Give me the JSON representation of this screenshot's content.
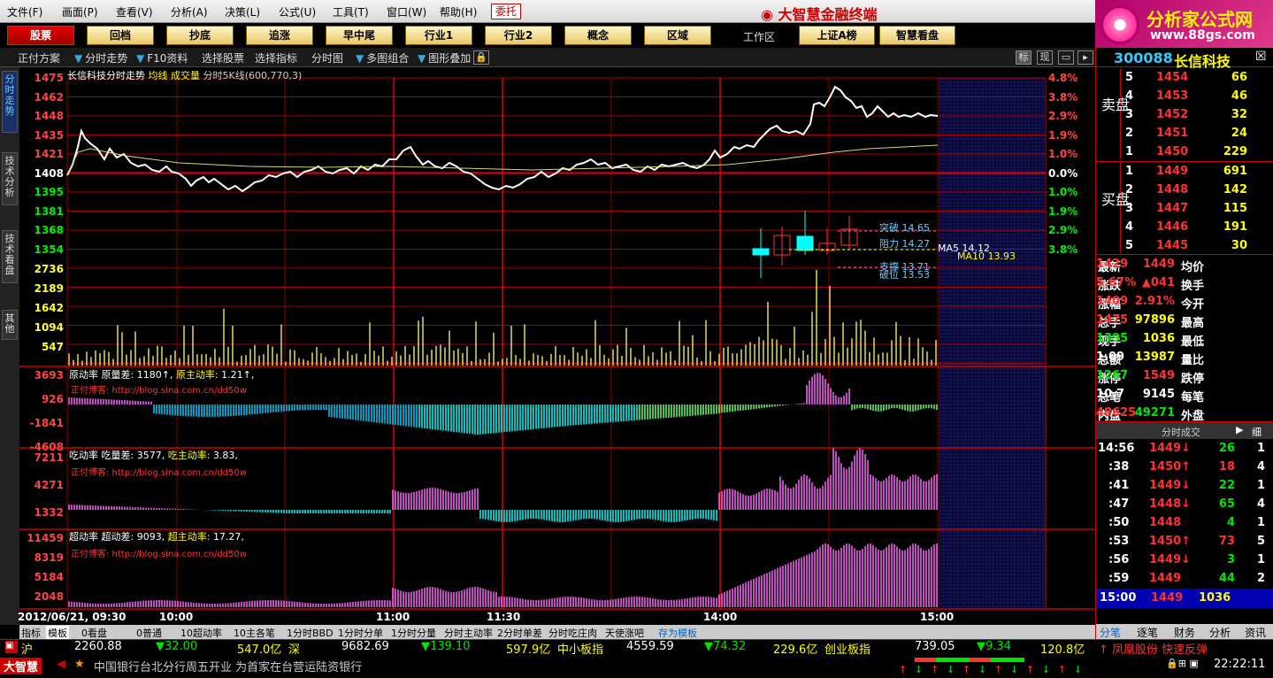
{
  "menu": [
    "文件(F)",
    "画面(P)",
    "查看(V)",
    "分析(A)",
    "决策(L)",
    "公式(U)",
    "工具(T)",
    "窗口(W)",
    "帮助(H)"
  ],
  "weituo": "委托",
  "brand_title": "大智慧金融终端",
  "logo": {
    "line1": "分析家公式网",
    "line2": "www.88gs.com"
  },
  "quick_buttons": [
    "股票",
    "回档",
    "抄底",
    "追涨",
    "早中尾",
    "行业1",
    "行业2",
    "概念",
    "区域"
  ],
  "workspace_label": "工作区",
  "workspace_buttons": [
    "上证A榜",
    "智慧看盘"
  ],
  "toolbar": [
    "正付方案",
    "分时走势",
    "F10资料",
    "选择股票",
    "选择指标",
    "分时图",
    "多图组合",
    "图形叠加"
  ],
  "toolbar_right": [
    "标",
    "现"
  ],
  "side_tabs": [
    "分时走势",
    "技术分析",
    "技术看盘",
    "其他"
  ],
  "chart": {
    "header_title": "长信科技分时走势",
    "header_avg": "均线",
    "header_vol": "成交量",
    "header_ma": "分时5K线(600,770,3)",
    "price_ticks": [
      "1475",
      "1462",
      "1448",
      "1435",
      "1421",
      "1408",
      "1395",
      "1381",
      "1368",
      "1354"
    ],
    "pct_ticks": [
      "4.8%",
      "3.8%",
      "2.9%",
      "1.9%",
      "1.0%",
      "0.0%",
      "1.0%",
      "1.9%",
      "2.9%",
      "3.8%"
    ],
    "vol_ticks": [
      "2736",
      "2189",
      "1642",
      "1094",
      "547"
    ],
    "candle_labels": {
      "tupo": "突破 14.65",
      "zuli": "阻力 14.27",
      "ma5": "MA5 14.12",
      "ma10": "MA10 13.93",
      "zhicheng": "支撑 13.71",
      "dixian": "破位 13.53"
    },
    "panel1": {
      "title_a": "原动率",
      "title_b": "原量差:",
      "val_b": "1180↑,",
      "title_c": "原主动率:",
      "val_c": "1.21↑,",
      "ticks": [
        "3693",
        "926",
        "-1841",
        "-4608"
      ]
    },
    "panel2": {
      "title_a": "吃动率",
      "title_b": "吃量差:",
      "val_b": "3577,",
      "title_c": "吃主动率:",
      "val_c": "3.83,",
      "ticks": [
        "7211",
        "4271",
        "1332"
      ]
    },
    "panel3": {
      "title_a": "超动率",
      "title_b": "超动差:",
      "val_b": "9093,",
      "title_c": "超主动率:",
      "val_c": "17.27,",
      "ticks": [
        "11459",
        "8319",
        "5184",
        "2048"
      ]
    },
    "blog_text": "正付博客: http://blog.sina.com.cn/dd50w",
    "time_labels": [
      "2012/06/21, 09:30",
      "10:00",
      "11:00",
      "11:30",
      "14:00",
      "15:00"
    ]
  },
  "bottom_tabs": [
    "指标",
    "模板",
    "0看盘",
    "0普通",
    "10超动率",
    "10主各笔",
    "1分时BBD",
    "1分时分单",
    "1分时分量",
    "分时主动率",
    "2分时单差",
    "分时吃庄肉",
    "天使涨吧",
    "存为模板"
  ],
  "quote": {
    "code": "300088",
    "name": "长信科技",
    "sell_label": "卖盘",
    "buy_label": "买盘",
    "asks": [
      {
        "n": "5",
        "p": "1454",
        "v": "66"
      },
      {
        "n": "4",
        "p": "1453",
        "v": "46"
      },
      {
        "n": "3",
        "p": "1452",
        "v": "32"
      },
      {
        "n": "2",
        "p": "1451",
        "v": "24"
      },
      {
        "n": "1",
        "p": "1450",
        "v": "229"
      }
    ],
    "bids": [
      {
        "n": "1",
        "p": "1449",
        "v": "691"
      },
      {
        "n": "2",
        "p": "1448",
        "v": "142"
      },
      {
        "n": "3",
        "p": "1447",
        "v": "115"
      },
      {
        "n": "4",
        "p": "1446",
        "v": "191"
      },
      {
        "n": "5",
        "p": "1445",
        "v": "30"
      }
    ],
    "stats": [
      {
        "k1": "最新",
        "v1": "1449",
        "k2": "均价",
        "v2": "1429"
      },
      {
        "k1": "涨跌",
        "v1": "▲041",
        "k2": "换手",
        "v2": "5.67%"
      },
      {
        "k1": "涨幅",
        "v1": "2.91%",
        "k2": "今开",
        "v2": "1409"
      },
      {
        "k1": "总手",
        "v1": "97896",
        "k2": "最高",
        "v2": "1475"
      },
      {
        "k1": "现手",
        "v1": "1036",
        "k2": "最低",
        "v2": "1395"
      },
      {
        "k1": "总额",
        "v1": "13987",
        "k2": "量比",
        "v2": "1.09"
      },
      {
        "k1": "涨停",
        "v1": "1549",
        "k2": "跌停",
        "v2": "1267"
      },
      {
        "k1": "总笔",
        "v1": "9145",
        "k2": "每笔",
        "v2": "10.7"
      },
      {
        "k1": "内盘",
        "v1": "49271",
        "k2": "外盘",
        "v2": "48625"
      }
    ],
    "ticks_title": "分时成交",
    "ticks_detail": "细",
    "ticks": [
      {
        "t": "14:56",
        "p": "1449↓",
        "v": "26",
        "n": "1"
      },
      {
        "t": ":38",
        "p": "1450↑",
        "v": "18",
        "n": "4"
      },
      {
        "t": ":41",
        "p": "1449↓",
        "v": "22",
        "n": "1"
      },
      {
        "t": ":47",
        "p": "1448↓",
        "v": "65",
        "n": "4"
      },
      {
        "t": ":50",
        "p": "1448",
        "v": "4",
        "n": "1"
      },
      {
        "t": ":53",
        "p": "1450↑",
        "v": "73",
        "n": "5"
      },
      {
        "t": ":56",
        "p": "1449↓",
        "v": "3",
        "n": "1"
      },
      {
        "t": ":59",
        "p": "1449",
        "v": "44",
        "n": "2"
      }
    ],
    "last_tick": {
      "t": "15:00",
      "p": "1449",
      "v": "1036"
    },
    "right_tabs": [
      "分笔",
      "逐笔",
      "财务",
      "分析",
      "资讯"
    ]
  },
  "status": {
    "sh_label": "沪",
    "sh_idx": "2260.88",
    "sh_chg": "▼32.00",
    "sh_amt": "547.0亿",
    "sz_label": "深",
    "sz_idx": "9682.69",
    "sz_chg": "▼139.10",
    "sz_amt": "597.9亿",
    "zx_label": "中小板指",
    "zx_idx": "4559.59",
    "zx_chg": "▼74.32",
    "zx_amt": "229.6亿",
    "cy_label": "创业板指",
    "cy_idx": "739.05",
    "cy_chg": "▼9.34",
    "cy_amt": "120.8亿",
    "alert": "↑ 凤凰股份 快速反弹",
    "logo": "大智慧",
    "news": "中国银行台北分行周五开业 为首家在台营运陆资银行",
    "clock": "22:22:11"
  }
}
